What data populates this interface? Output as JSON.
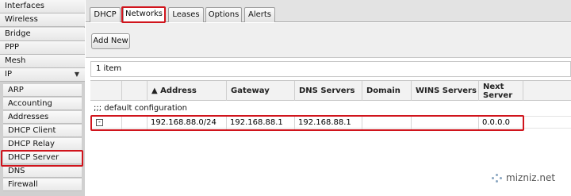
{
  "sidebar": {
    "items": [
      {
        "label": "Interfaces"
      },
      {
        "label": "Wireless"
      },
      {
        "label": "Bridge"
      },
      {
        "label": "PPP"
      },
      {
        "label": "Mesh"
      },
      {
        "label": "IP",
        "expanded": true
      }
    ],
    "ip_submenu": [
      {
        "label": "ARP"
      },
      {
        "label": "Accounting"
      },
      {
        "label": "Addresses"
      },
      {
        "label": "DHCP Client"
      },
      {
        "label": "DHCP Relay"
      },
      {
        "label": "DHCP Server",
        "selected": true
      },
      {
        "label": "DNS"
      },
      {
        "label": "Firewall"
      }
    ]
  },
  "tabs": [
    {
      "label": "DHCP"
    },
    {
      "label": "Networks",
      "active": true
    },
    {
      "label": "Leases"
    },
    {
      "label": "Options"
    },
    {
      "label": "Alerts"
    }
  ],
  "toolbar": {
    "add_new_label": "Add New"
  },
  "list": {
    "count_text": "1 item",
    "columns": [
      "",
      "",
      "▲ Address",
      "Gateway",
      "DNS Servers",
      "Domain",
      "WINS Servers",
      "Next Server"
    ],
    "comment": ";;; default configuration",
    "rows": [
      {
        "flag": "-",
        "address": "192.168.88.0/24",
        "gateway": "192.168.88.1",
        "dns_servers": "192.168.88.1",
        "domain": "",
        "wins_servers": "",
        "next_server": "0.0.0.0"
      }
    ]
  },
  "watermark": {
    "text": "mizniz.net"
  },
  "colors": {
    "highlight": "#d0141c"
  }
}
